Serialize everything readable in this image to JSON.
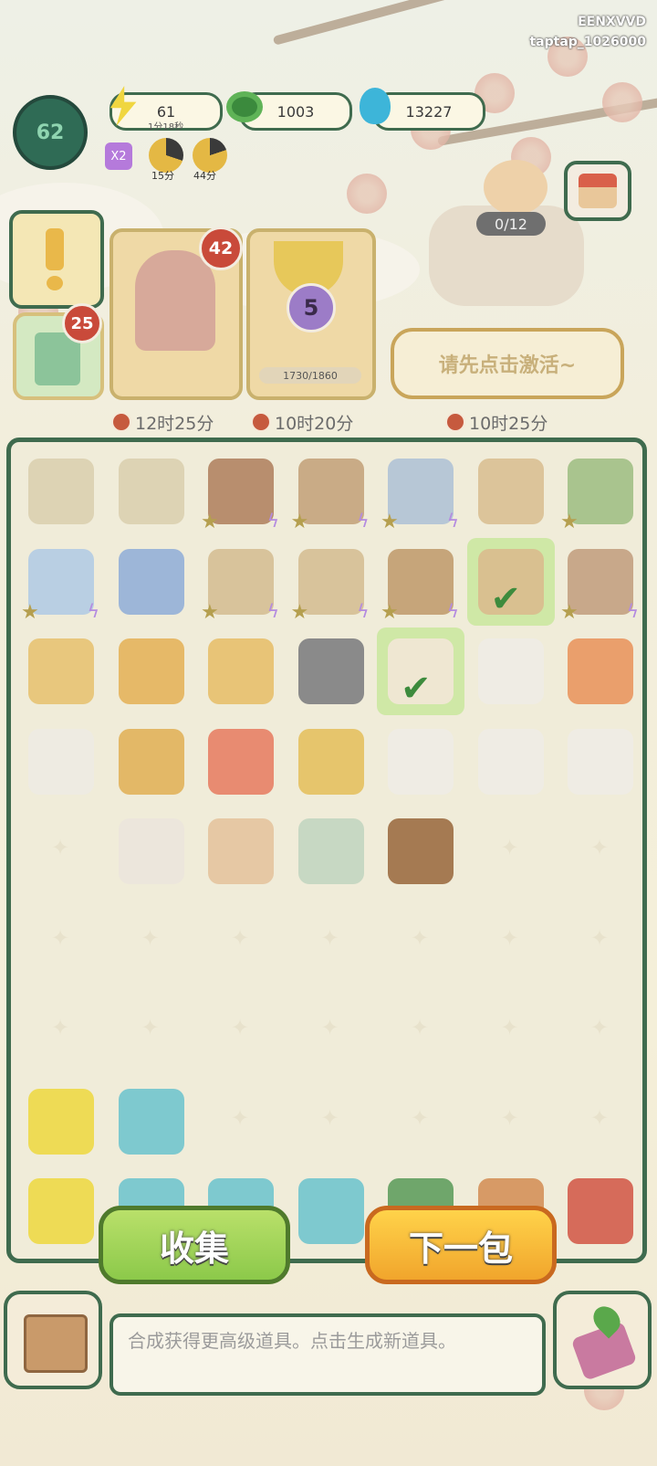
{
  "watermark": {
    "line1": "EENXVVD",
    "line2": "taptap_1026000"
  },
  "hud": {
    "level": "62",
    "energy": "61",
    "energy_timer": "1分18秒",
    "coins": "1003",
    "gems": "13227",
    "boost_label": "X2",
    "boost1_timer": "15分",
    "boost2_timer": "44分"
  },
  "cards": {
    "gift_count": "25",
    "character_badge": "42",
    "trophy_level": "5",
    "trophy_progress": "1730/1860",
    "worker_count": "0/12",
    "activate_text": "请先点击激活~",
    "timer1": "12时25分",
    "timer2": "10时20分",
    "timer3": "10时25分"
  },
  "board": {
    "rows": [
      [
        {
          "icon": "scroll-icon",
          "c": "#ddd3b4"
        },
        {
          "icon": "scroll-icon",
          "c": "#ddd3b4"
        },
        {
          "icon": "shrine-icon",
          "c": "#b88e6e",
          "star": 1,
          "bolt": 1
        },
        {
          "icon": "cabinet-icon",
          "c": "#c9ab86",
          "star": 1,
          "bolt": 1
        },
        {
          "icon": "building-icon",
          "c": "#b7c7d6",
          "star": 1,
          "bolt": 1
        },
        {
          "icon": "doghouse-icon",
          "c": "#dcc49a"
        },
        {
          "icon": "leaves-icon",
          "c": "#a9c48e",
          "star": 1
        }
      ],
      [
        {
          "icon": "vase-icon",
          "c": "#b9cfe3",
          "star": 1,
          "bolt": 1
        },
        {
          "icon": "vase-icon",
          "c": "#9db6d8"
        },
        {
          "icon": "gate-icon",
          "c": "#d8c39b",
          "star": 1,
          "bolt": 1
        },
        {
          "icon": "gate-icon",
          "c": "#d8c39b",
          "star": 1,
          "bolt": 1
        },
        {
          "icon": "loom-icon",
          "c": "#c6a57a",
          "star": 1,
          "bolt": 1
        },
        {
          "icon": "tray-icon",
          "c": "#d9c090",
          "green": 1,
          "check": 1
        },
        {
          "icon": "mortar-icon",
          "c": "#c8a88a",
          "star": 1,
          "bolt": 1
        }
      ],
      [
        {
          "icon": "mooncake-icon",
          "c": "#e8c77d"
        },
        {
          "icon": "amulet-icon",
          "c": "#e6b968"
        },
        {
          "icon": "tag-icon",
          "c": "#e8c477"
        },
        {
          "icon": "husky-icon",
          "c": "#8a8a8a"
        },
        {
          "icon": "paper-icon",
          "c": "#efe7d2",
          "green": 1,
          "check": 1
        },
        {
          "icon": "dog-icon",
          "c": "#efece4"
        },
        {
          "icon": "carrot-icon",
          "c": "#ea9f6c"
        }
      ],
      [
        {
          "icon": "bowl-icon",
          "c": "#eeebe2"
        },
        {
          "icon": "bracelet-icon",
          "c": "#e3b867"
        },
        {
          "icon": "ham-icon",
          "c": "#e88b71"
        },
        {
          "icon": "rings-icon",
          "c": "#e6c56c"
        },
        {
          "icon": "dog-icon",
          "c": "#efece4"
        },
        {
          "icon": "dog-icon",
          "c": "#efece4"
        },
        {
          "icon": "dog-icon",
          "c": "#efece4"
        }
      ],
      [
        {
          "icon": ""
        },
        {
          "icon": "chihuahua-icon",
          "c": "#ece6dc"
        },
        {
          "icon": "shiba-icon",
          "c": "#e6c8a4"
        },
        {
          "icon": "soup-bowl-icon",
          "c": "#c7d8c3"
        },
        {
          "icon": "bean-icon",
          "c": "#a57a52"
        },
        {
          "icon": ""
        },
        {
          "icon": ""
        }
      ],
      [
        {
          "icon": ""
        },
        {
          "icon": ""
        },
        {
          "icon": ""
        },
        {
          "icon": ""
        },
        {
          "icon": ""
        },
        {
          "icon": ""
        },
        {
          "icon": ""
        }
      ],
      [
        {
          "icon": ""
        },
        {
          "icon": ""
        },
        {
          "icon": ""
        },
        {
          "icon": ""
        },
        {
          "icon": ""
        },
        {
          "icon": ""
        },
        {
          "icon": ""
        }
      ],
      [
        {
          "icon": "gold-icon",
          "c": "#eedb55"
        },
        {
          "icon": "blue-flame-icon",
          "c": "#7ec9cf"
        },
        {
          "icon": ""
        },
        {
          "icon": ""
        },
        {
          "icon": ""
        },
        {
          "icon": ""
        },
        {
          "icon": ""
        }
      ],
      [
        {
          "icon": "gold-pile-icon",
          "c": "#eedb55"
        },
        {
          "icon": "blue-flame-icon",
          "c": "#7ec9cf"
        },
        {
          "icon": "blue-flame-icon",
          "c": "#7ec9cf"
        },
        {
          "icon": "blue-flame-icon",
          "c": "#7ec9cf"
        },
        {
          "icon": "jade-coin-icon",
          "c": "#6fa66b"
        },
        {
          "icon": "money-bag-icon",
          "c": "#d79a66"
        },
        {
          "icon": "treasure-icon",
          "c": "#d66b5a"
        }
      ]
    ]
  },
  "buttons": {
    "collect": "收集",
    "next_pack": "下一包"
  },
  "description": "合成获得更高级道具。点击生成新道具。",
  "colors": {
    "board_border": "#3f6b4e",
    "collect": "#9ad352",
    "next": "#f6b836"
  }
}
